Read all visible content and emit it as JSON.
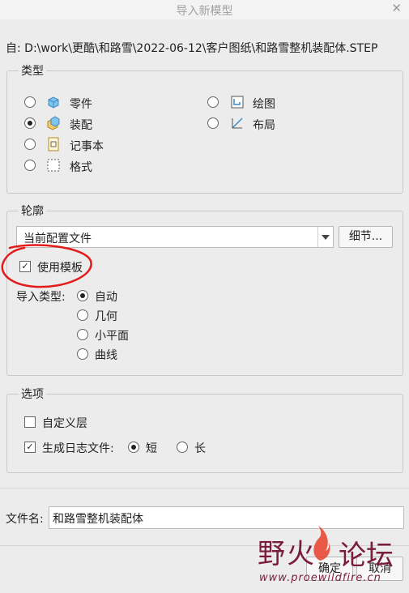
{
  "window": {
    "title": "导入新模型",
    "close_glyph": "✕"
  },
  "from": {
    "label": "自:",
    "path": "D:\\work\\更酷\\和路雪\\2022-06-12\\客户图纸\\和路雪整机装配体.STEP"
  },
  "type_group": {
    "title": "类型",
    "options": [
      {
        "label": "零件",
        "icon": "part-icon",
        "selected": false
      },
      {
        "label": "装配",
        "icon": "assembly-icon",
        "selected": true
      },
      {
        "label": "记事本",
        "icon": "notebook-icon",
        "selected": false
      },
      {
        "label": "格式",
        "icon": "format-icon",
        "selected": false
      },
      {
        "label": "绘图",
        "icon": "drawing-icon",
        "selected": false
      },
      {
        "label": "布局",
        "icon": "layout-icon",
        "selected": false
      }
    ]
  },
  "profile_group": {
    "title": "轮廓",
    "config_value": "当前配置文件",
    "details_button": "细节...",
    "use_template": {
      "label": "使用模板",
      "checked": true
    },
    "import_type_label": "导入类型:",
    "import_types": [
      {
        "label": "自动",
        "selected": true
      },
      {
        "label": "几何",
        "selected": false
      },
      {
        "label": "小平面",
        "selected": false
      },
      {
        "label": "曲线",
        "selected": false
      }
    ]
  },
  "options_group": {
    "title": "选项",
    "custom_layer": {
      "label": "自定义层",
      "checked": false
    },
    "log_file": {
      "label": "生成日志文件:",
      "checked": true
    },
    "log_options": [
      {
        "label": "短",
        "selected": true
      },
      {
        "label": "长",
        "selected": false
      }
    ]
  },
  "filename": {
    "label": "文件名:",
    "value": "和路雪整机装配体"
  },
  "buttons": {
    "ok": "确定",
    "cancel": "取消"
  },
  "watermark": {
    "text_left": "野火",
    "text_right": "论坛",
    "url": "www.proewildfire.cn"
  },
  "colors": {
    "annotation": "#e41b1b",
    "watermark": "#7a1d3a"
  }
}
